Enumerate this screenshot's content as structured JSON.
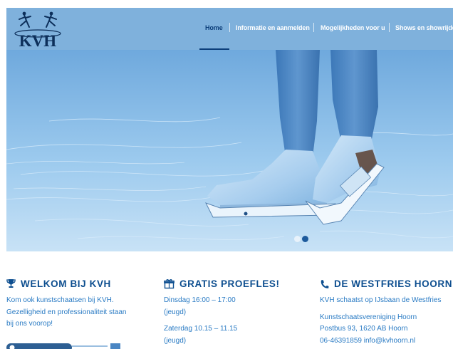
{
  "brand": {
    "logo_text": "KVH"
  },
  "nav": {
    "items": [
      {
        "label": "Home",
        "active": true
      },
      {
        "label": "Informatie en aanmelden",
        "active": false
      },
      {
        "label": "Mogelijkheden voor u",
        "active": false
      },
      {
        "label": "Shows en showrijden",
        "active": false
      }
    ]
  },
  "slider": {
    "active_slide": 2,
    "slide_count": 2
  },
  "columns": {
    "welkom": {
      "icon": "trophy-icon",
      "title": "WELKOM BIJ KVH",
      "lines": [
        "Kom ook kunstschaatsen bij KVH.",
        "Gezelligheid en professionaliteit staan",
        "bij ons voorop!"
      ]
    },
    "proefles": {
      "icon": "gift-icon",
      "title": "GRATIS PROEFLES!",
      "block1": [
        "Dinsdag 16:00 – 17:00",
        "(jeugd)"
      ],
      "block2": [
        "Zaterdag 10.15 – 11.15",
        "(jeugd)"
      ]
    },
    "westfries": {
      "icon": "phone-icon",
      "title": "DE WESTFRIES HOORN",
      "intro": "KVH schaatst op  IJsbaan de Westfries",
      "address": [
        "Kunstschaatsvereniging Hoorn",
        "Postbus 93, 1620 AB Hoorn",
        "06-46391859  info@kvhoorn.nl"
      ]
    }
  },
  "colors": {
    "header": "#7fb1dc",
    "accent": "#0d4e8f",
    "link": "#2a7bc4"
  }
}
